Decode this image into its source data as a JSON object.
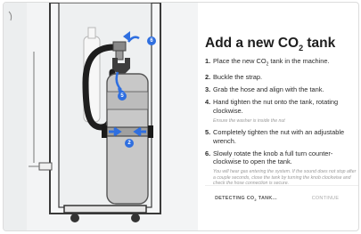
{
  "title": {
    "text": "Add a new CO",
    "sub": "2",
    "suffix": " tank"
  },
  "steps": [
    {
      "num": "1.",
      "text_a": "Place the new CO",
      "text_sub": "2",
      "text_b": " tank in the machine."
    },
    {
      "num": "2.",
      "text": "Buckle the strap."
    },
    {
      "num": "3.",
      "text": "Grab the hose and align with the tank."
    },
    {
      "num": "4.",
      "text": "Hand tighten the nut onto the tank, rotating clockwise."
    },
    {
      "num": "5.",
      "text": "Completely tighten the nut with an adjustable wrench."
    },
    {
      "num": "6.",
      "text": "Slowly rotate the knob a full turn counter-clockwise to open the tank."
    }
  ],
  "notes": {
    "after_step_4": "Ensure the washer is inside the nut",
    "after_step_6": "You will hear gas entering the system. If the sound does not stop after a couple seconds, close the tank by turning the knob clockwise and check the hose connection is secure."
  },
  "buttons": {
    "detecting": {
      "text": "DETECTING CO",
      "sub": "2",
      "suffix": " TANK..."
    },
    "continue": "CONTINUE"
  },
  "illustration": {
    "markers": [
      "6",
      "5",
      "2"
    ],
    "accent_color": "#2f6fe0"
  }
}
